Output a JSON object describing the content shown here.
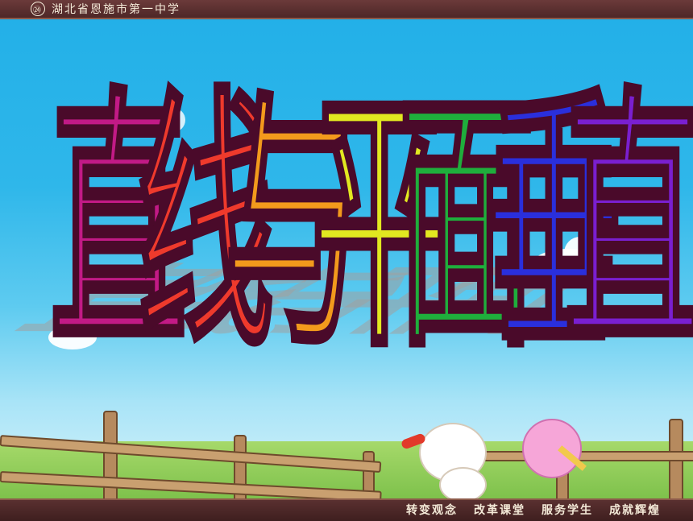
{
  "header": {
    "logo_glyph": "㉔",
    "school_name": "湖北省恩施市第一中学"
  },
  "title": {
    "characters": [
      {
        "text": "直",
        "color": "#c21a86"
      },
      {
        "text": "线",
        "color": "#ef3a2c"
      },
      {
        "text": "与",
        "color": "#f39a1c"
      },
      {
        "text": "平",
        "color": "#e2e820"
      },
      {
        "text": "面",
        "color": "#1fae3c"
      },
      {
        "text": "垂",
        "color": "#2a2fdc"
      },
      {
        "text": "直",
        "color": "#7a1fd0"
      }
    ]
  },
  "footer": {
    "motto": [
      "转变观念",
      "改革课堂",
      "服务学生",
      "成就辉煌"
    ]
  }
}
